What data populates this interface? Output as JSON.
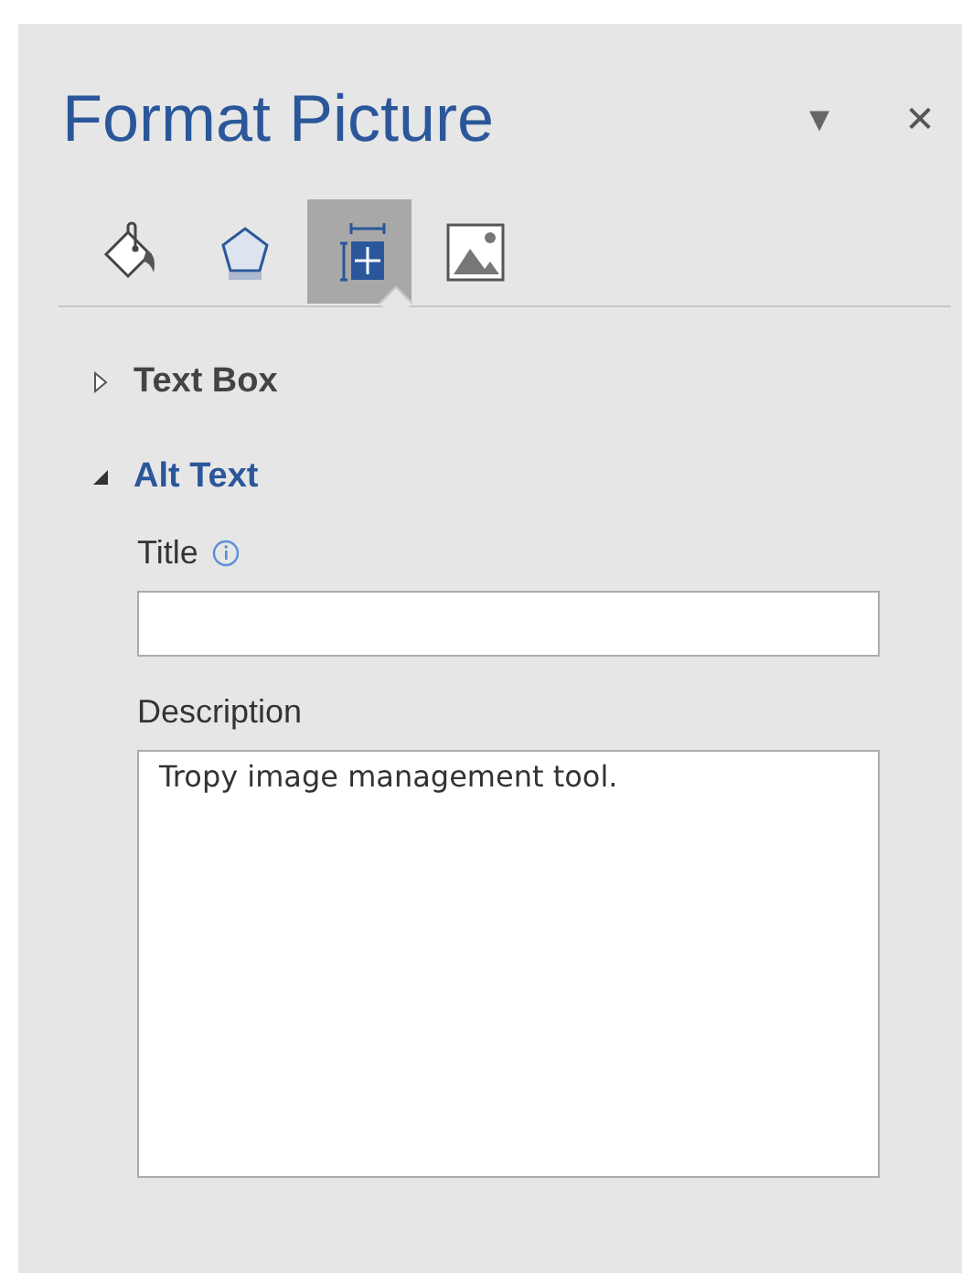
{
  "pane": {
    "title": "Format Picture",
    "menu_glyph": "▾",
    "close_glyph": "✕"
  },
  "tabs": [
    {
      "kind": "fill",
      "selected": false
    },
    {
      "kind": "effects",
      "selected": false
    },
    {
      "kind": "layout",
      "selected": true
    },
    {
      "kind": "picture",
      "selected": false
    }
  ],
  "sections": [
    {
      "label": "Text Box",
      "expanded": false
    },
    {
      "label": "Alt Text",
      "expanded": true,
      "fields": [
        {
          "kind": "input",
          "label": "Title",
          "info": true
        },
        {
          "kind": "textarea",
          "label": "Description",
          "info": false,
          "value": "Tropy image management tool."
        }
      ]
    }
  ]
}
